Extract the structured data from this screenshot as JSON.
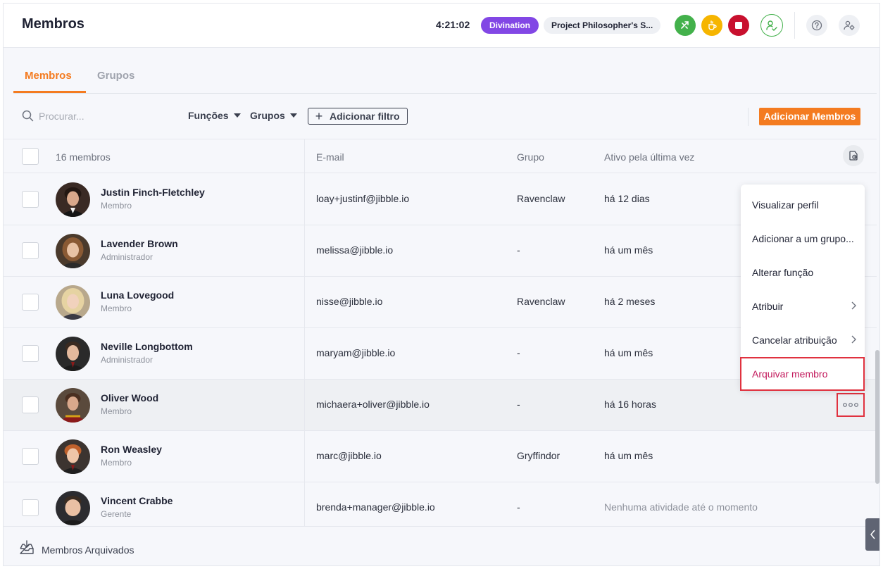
{
  "header": {
    "title": "Membros",
    "timer": "4:21:02",
    "activity": "Divination",
    "project": "Project Philosopher's S...",
    "colors": {
      "green": "#43b14b",
      "yellow": "#f6b500",
      "red": "#c8102e",
      "accent": "#f47b20",
      "activity": "#8247e5"
    }
  },
  "tabs": [
    {
      "label": "Membros",
      "active": true
    },
    {
      "label": "Grupos",
      "active": false
    }
  ],
  "filters": {
    "search_placeholder": "Procurar...",
    "funcoes": "Funções",
    "grupos": "Grupos",
    "add_filter": "Adicionar filtro",
    "add_members": "Adicionar Membros"
  },
  "table": {
    "count_label": "16 membros",
    "columns": {
      "email": "E-mail",
      "group": "Grupo",
      "last_active": "Ativo pela última vez"
    },
    "rows": [
      {
        "name": "Justin Finch-Fletchley",
        "role": "Membro",
        "email": "loay+justinf@jibble.io",
        "group": "Ravenclaw",
        "last_active": "há 12 dias"
      },
      {
        "name": "Lavender Brown",
        "role": "Administrador",
        "email": "melissa@jibble.io",
        "group": "-",
        "last_active": "há um mês"
      },
      {
        "name": "Luna Lovegood",
        "role": "Membro",
        "email": "nisse@jibble.io",
        "group": "Ravenclaw",
        "last_active": "há 2 meses"
      },
      {
        "name": "Neville Longbottom",
        "role": "Administrador",
        "email": "maryam@jibble.io",
        "group": "-",
        "last_active": "há um mês"
      },
      {
        "name": "Oliver Wood",
        "role": "Membro",
        "email": "michaera+oliver@jibble.io",
        "group": "-",
        "last_active": "há 16 horas"
      },
      {
        "name": "Ron Weasley",
        "role": "Membro",
        "email": "marc@jibble.io",
        "group": "Gryffindor",
        "last_active": "há um mês"
      },
      {
        "name": "Vincent Crabbe",
        "role": "Gerente",
        "email": "brenda+manager@jibble.io",
        "group": "-",
        "last_active": "Nenhuma atividade até o momento"
      }
    ]
  },
  "menu": {
    "items": [
      {
        "label": "Visualizar perfil"
      },
      {
        "label": "Adicionar a um grupo..."
      },
      {
        "label": "Alterar função"
      },
      {
        "label": "Atribuir"
      },
      {
        "label": "Cancelar atribuição"
      },
      {
        "label": "Arquivar membro"
      }
    ]
  },
  "footer": {
    "archived_label": "Membros Arquivados"
  }
}
